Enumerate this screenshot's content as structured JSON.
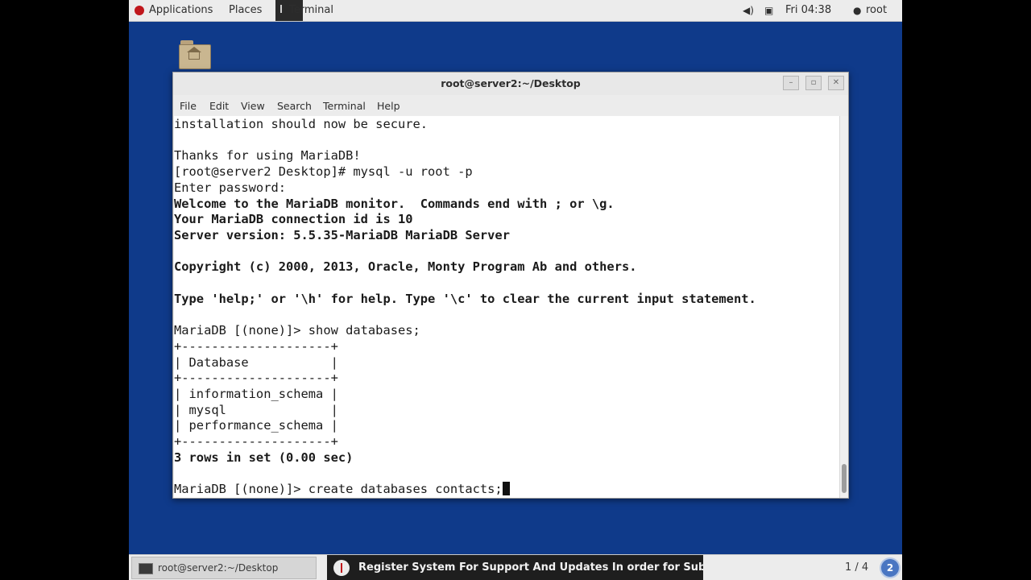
{
  "topbar": {
    "applications": "Applications",
    "places": "Places",
    "active_app": "Terminal",
    "clock": "Fri 04:38",
    "user": "root",
    "volume_icon": "speaker-icon",
    "network_icon": "network-icon",
    "user_icon": "user-icon"
  },
  "desktop": {
    "home_icon": "home-folder-icon"
  },
  "window": {
    "title": "root@server2:~/Desktop",
    "minimize": "–",
    "maximize": "▫",
    "close": "✕",
    "menu": [
      "File",
      "Edit",
      "View",
      "Search",
      "Terminal",
      "Help"
    ]
  },
  "terminal": {
    "lines": [
      {
        "text": "installation should now be secure.",
        "bold": false
      },
      {
        "text": "",
        "bold": false
      },
      {
        "text": "Thanks for using MariaDB!",
        "bold": false
      },
      {
        "text": "[root@server2 Desktop]# mysql -u root -p",
        "bold": false
      },
      {
        "text": "Enter password:",
        "bold": false
      },
      {
        "text": "Welcome to the MariaDB monitor.  Commands end with ; or \\g.",
        "bold": true
      },
      {
        "text": "Your MariaDB connection id is 10",
        "bold": true
      },
      {
        "text": "Server version: 5.5.35-MariaDB MariaDB Server",
        "bold": true
      },
      {
        "text": "",
        "bold": false
      },
      {
        "text": "Copyright (c) 2000, 2013, Oracle, Monty Program Ab and others.",
        "bold": true
      },
      {
        "text": "",
        "bold": false
      },
      {
        "text": "Type 'help;' or '\\h' for help. Type '\\c' to clear the current input statement.",
        "bold": true
      },
      {
        "text": "",
        "bold": false
      },
      {
        "text": "MariaDB [(none)]> show databases;",
        "bold": false
      },
      {
        "text": "+--------------------+",
        "bold": false
      },
      {
        "text": "| Database           |",
        "bold": false
      },
      {
        "text": "+--------------------+",
        "bold": false
      },
      {
        "text": "| information_schema |",
        "bold": false
      },
      {
        "text": "| mysql              |",
        "bold": false
      },
      {
        "text": "| performance_schema |",
        "bold": false
      },
      {
        "text": "+--------------------+",
        "bold": false
      },
      {
        "text": "3 rows in set (0.00 sec)",
        "bold": true
      },
      {
        "text": "",
        "bold": false
      },
      {
        "text": "MariaDB [(none)]> create databases contacts;",
        "bold": false,
        "cursor": true
      }
    ]
  },
  "taskbar": {
    "task_label": "root@server2:~/Desktop",
    "notification": "Register System For Support And Updates  In order for Subs...",
    "workspace": "1 / 4",
    "workspace_badge": "2"
  }
}
